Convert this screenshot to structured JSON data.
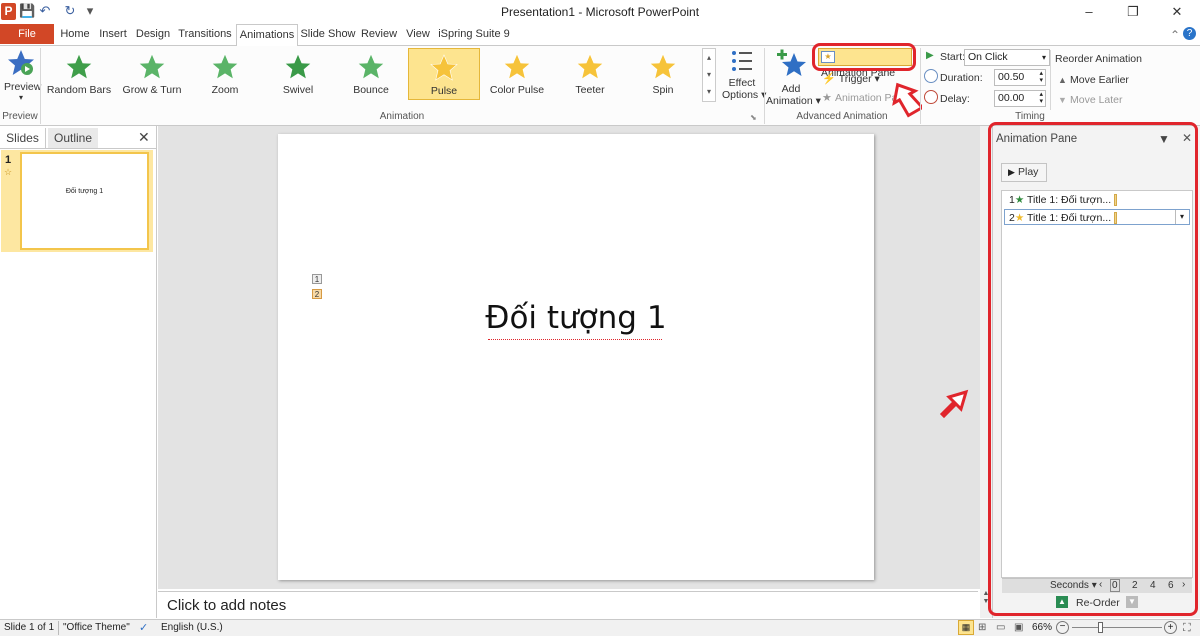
{
  "window": {
    "title": "Presentation1 - Microsoft PowerPoint",
    "min": "–",
    "max": "❐",
    "close": "✕"
  },
  "qat": {
    "logo": "P",
    "save": "💾",
    "undo": "↶",
    "redo": "↻",
    "more": "▾"
  },
  "tabs": [
    "Home",
    "Insert",
    "Design",
    "Transitions",
    "Animations",
    "Slide Show",
    "Review",
    "View",
    "iSpring Suite 9"
  ],
  "file_tab": "File",
  "ribbon": {
    "preview": {
      "label": "Preview",
      "group": "Preview"
    },
    "animation_group": "Animation",
    "effects": [
      {
        "label": "Random Bars",
        "color": "#3f9e4a"
      },
      {
        "label": "Grow & Turn",
        "color": "#5bb468"
      },
      {
        "label": "Zoom",
        "color": "#5bb468"
      },
      {
        "label": "Swivel",
        "color": "#3a9a48"
      },
      {
        "label": "Bounce",
        "color": "#5bb468"
      },
      {
        "label": "Pulse",
        "color": "#f6c33a"
      },
      {
        "label": "Color Pulse",
        "color": "#f6c33a"
      },
      {
        "label": "Teeter",
        "color": "#f6c33a"
      },
      {
        "label": "Spin",
        "color": "#f6c33a"
      }
    ],
    "effect_options": [
      "Effect",
      "Options ▾"
    ],
    "add_animation": [
      "Add",
      "Animation ▾"
    ],
    "animation_pane_btn": "Animation Pane",
    "trigger": "Trigger ▾",
    "animation_painter": "Animation Painter",
    "advanced_group": "Advanced Animation",
    "start_label": "Start:",
    "start_value": "On Click",
    "duration_label": "Duration:",
    "duration_value": "00.50",
    "delay_label": "Delay:",
    "delay_value": "00.00",
    "reorder_title": "Reorder Animation",
    "move_earlier": "Move Earlier",
    "move_later": "Move Later",
    "timing_group": "Timing"
  },
  "left_panel": {
    "tab_slides": "Slides",
    "tab_outline": "Outline",
    "close": "✕",
    "slide_number": "1",
    "thumb_text": "Đối tượng 1"
  },
  "slide": {
    "title": "Đối tượng 1",
    "tags": [
      "1",
      "2"
    ]
  },
  "notes": {
    "placeholder": "Click to add notes"
  },
  "anim_pane": {
    "title": "Animation Pane",
    "play": "Play",
    "items": [
      {
        "num": "1",
        "label": "Title 1: Đối tượn...",
        "color": "#2f8a3c"
      },
      {
        "num": "2",
        "label": "Title 1: Đối tượn...",
        "color": "#f0bb2c"
      }
    ],
    "seconds": "Seconds ▾",
    "ticks": [
      "0",
      "2",
      "4",
      "6"
    ],
    "reorder": "Re-Order"
  },
  "status": {
    "slide": "Slide 1 of 1",
    "theme": "\"Office Theme\"",
    "language": "English (U.S.)",
    "zoom": "66%"
  },
  "colors": {
    "accent": "#d24726",
    "highlight": "#e0252c"
  }
}
